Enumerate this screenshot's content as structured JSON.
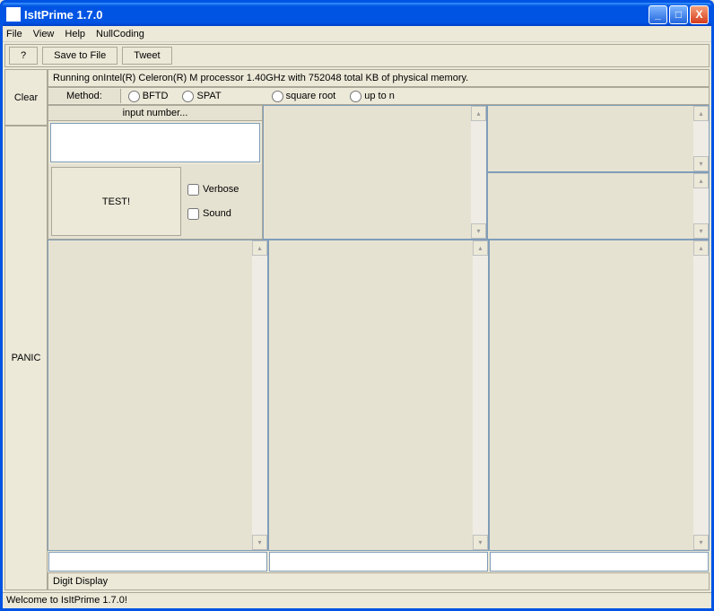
{
  "window": {
    "title": "IsItPrime 1.7.0"
  },
  "menubar": {
    "file": "File",
    "view": "View",
    "help": "Help",
    "nullcoding": "NullCoding"
  },
  "toolbar": {
    "help_label": "?",
    "save_label": "Save to File",
    "tweet_label": "Tweet"
  },
  "left": {
    "clear": "Clear",
    "panic": "PANIC"
  },
  "info": {
    "running": "Running onIntel(R) Celeron(R) M processor          1.40GHz with 752048 total KB of physical memory."
  },
  "method": {
    "label": "Method:",
    "bftd": "BFTD",
    "spat": "SPAT",
    "sqrt": "square root",
    "upton": "up to n"
  },
  "input": {
    "placeholder": "input number..."
  },
  "test": {
    "label": "TEST!",
    "verbose": "Verbose",
    "sound": "Sound"
  },
  "digit": {
    "label": "Digit Display"
  },
  "status": {
    "text": "Welcome to IsItPrime 1.7.0!"
  }
}
